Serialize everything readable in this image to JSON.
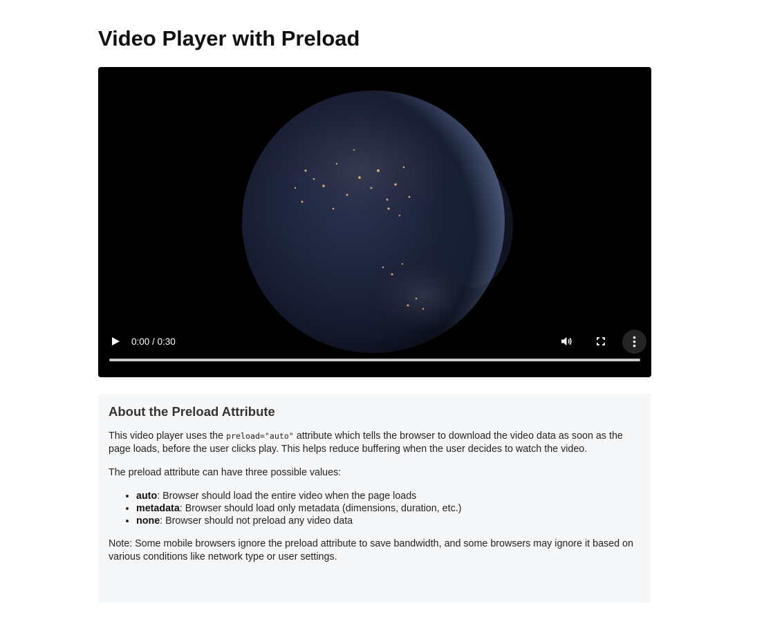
{
  "page": {
    "title": "Video Player with Preload"
  },
  "player": {
    "time": "0:00 / 0:30",
    "progress_fraction": 0,
    "icons": {
      "play": "play-icon",
      "volume": "volume-icon",
      "fullscreen": "fullscreen-icon",
      "more": "more-options-icon"
    }
  },
  "info": {
    "heading": "About the Preload Attribute",
    "para1_pre": "This video player uses the ",
    "para1_code": "preload=\"auto\"",
    "para1_post": " attribute which tells the browser to download the video data as soon as the page loads, before the user clicks play. This helps reduce buffering when the user decides to watch the video.",
    "para2": "The preload attribute can have three possible values:",
    "items": [
      {
        "term": "auto",
        "desc": ": Browser should load the entire video when the page loads"
      },
      {
        "term": "metadata",
        "desc": ": Browser should load only metadata (dimensions, duration, etc.)"
      },
      {
        "term": "none",
        "desc": ": Browser should not preload any video data"
      }
    ],
    "note": "Note: Some mobile browsers ignore the preload attribute to save bandwidth, and some browsers may ignore it based on various conditions like network type or user settings."
  },
  "colors": {
    "page_bg": "#ffffff",
    "player_bg": "#000000",
    "info_bg": "#f5f7f9"
  }
}
